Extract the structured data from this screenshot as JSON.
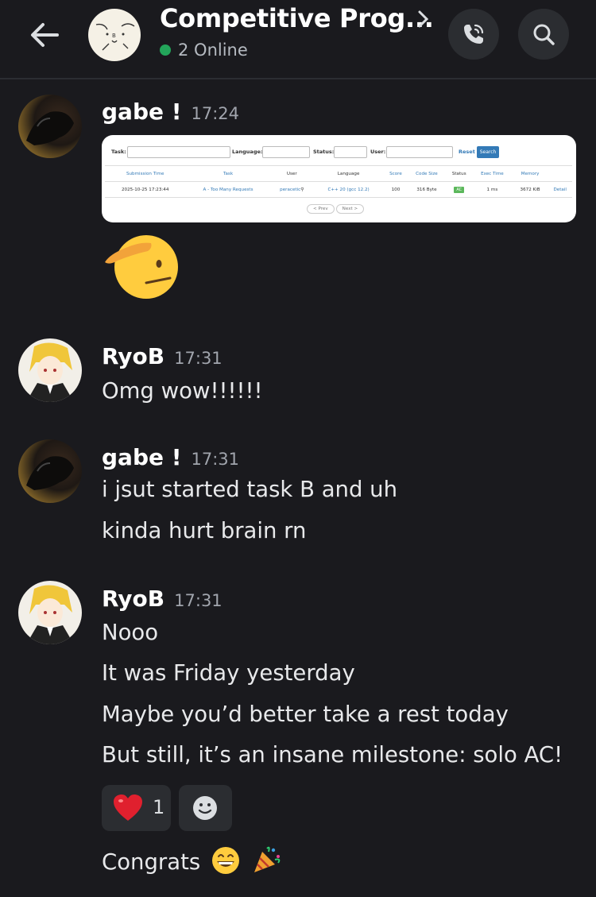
{
  "header": {
    "title": "Competitive Prog...",
    "online_text": "2 Online",
    "status_color": "#23a55a",
    "icons": [
      "arrow-left-icon",
      "chevron-right-icon",
      "phone-icon",
      "search-icon"
    ]
  },
  "attachment": {
    "filters": {
      "task": "Task:",
      "language": "Language:",
      "status": "Status:",
      "user": "User:",
      "reset": "Reset",
      "search": "Search",
      "blank": "-"
    },
    "columns": [
      "Submission Time",
      "Task",
      "User",
      "Language",
      "Score",
      "Code Size",
      "Status",
      "Exec Time",
      "Memory",
      ""
    ],
    "row": {
      "time": "2025-10-25 17:23:44",
      "task": "A - Too Many Requests",
      "user": "peracetic",
      "language": "C++ 20 (gcc 12.2)",
      "score": "100",
      "code_size": "316 Byte",
      "status": "AC",
      "exec_time": "1 ms",
      "memory": "3672 KiB",
      "detail": "Detail"
    },
    "pager": {
      "prev": "< Prev",
      "next": "Next >"
    }
  },
  "messages": [
    {
      "author": "gabe !",
      "time": "17:24",
      "emoji": "saluting-face"
    },
    {
      "author": "RyoB",
      "time": "17:31",
      "lines": [
        "Omg wow!!!!!!"
      ]
    },
    {
      "author": "gabe !",
      "time": "17:31",
      "lines": [
        "i jsut started task B and uh",
        "kinda hurt brain rn"
      ]
    },
    {
      "author": "RyoB",
      "time": "17:31",
      "lines": [
        "Nooo",
        "It was Friday yesterday",
        "Maybe you’d better take a rest today",
        "But still, it’s an insane milestone: solo AC!"
      ]
    }
  ],
  "reactions": [
    {
      "emoji": "heart",
      "count": "1"
    },
    {
      "emoji": "add-reaction"
    }
  ],
  "last_line": "Congrats"
}
